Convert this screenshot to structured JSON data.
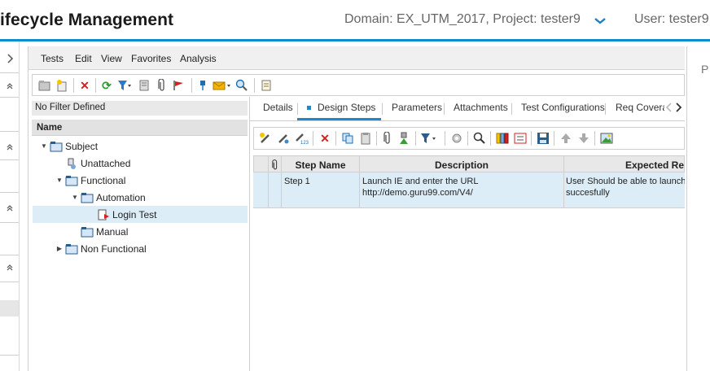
{
  "header": {
    "app_title": "ifecycle Management",
    "domain_project": "Domain: EX_UTM_2017, Project: tester9",
    "user": "User: tester9",
    "accent_color": "#0a8ecf"
  },
  "rail": {
    "icons": [
      "chevron-right-icon",
      "double-chevron-up-icon",
      "double-chevron-up-icon",
      "double-chevron-up-icon",
      "double-chevron-up-icon"
    ]
  },
  "menu": {
    "items": [
      "Tests",
      "Edit",
      "View",
      "Favorites",
      "Analysis"
    ]
  },
  "toolbar1": {
    "icons": [
      "new-folder-icon",
      "new-test-icon",
      "delete-icon",
      "refresh-icon",
      "filter-icon",
      "details-icon",
      "attachment-icon",
      "flag-icon",
      "pin-icon",
      "send-mail-icon",
      "zoom-icon",
      "notes-icon"
    ]
  },
  "tree": {
    "filter_text": "No Filter Defined",
    "column_header": "Name",
    "nodes": [
      {
        "label": "Subject"
      },
      {
        "label": "Unattached"
      },
      {
        "label": "Functional"
      },
      {
        "label": "Automation"
      },
      {
        "label": "Login Test"
      },
      {
        "label": "Manual"
      },
      {
        "label": "Non Functional"
      }
    ]
  },
  "tabs": {
    "items": [
      "Details",
      "Design Steps",
      "Parameters",
      "Attachments",
      "Test Configurations",
      "Req Coverag"
    ],
    "active": "Design Steps"
  },
  "toolbar2": {
    "icons": [
      "new-step-icon",
      "edit-step-icon",
      "renumber-steps-icon",
      "delete-icon",
      "copy-icon",
      "paste-icon",
      "attachment-icon",
      "call-to-test-icon",
      "filter-icon",
      "generate-script-icon",
      "find-icon",
      "columns-icon",
      "wrap-text-icon",
      "save-icon",
      "move-up-icon",
      "move-down-icon",
      "picture-icon"
    ]
  },
  "grid": {
    "columns": [
      "Step Name",
      "Description",
      "Expected Re"
    ],
    "rows": [
      {
        "step_name": "Step 1",
        "description_line1": "Launch IE and enter the URL",
        "description_line2": "http://demo.guru99.com/V4/",
        "expected_line1": "User Should be able to launch",
        "expected_line2": "succesfully"
      }
    ]
  },
  "right_strip": {
    "label": "P"
  }
}
